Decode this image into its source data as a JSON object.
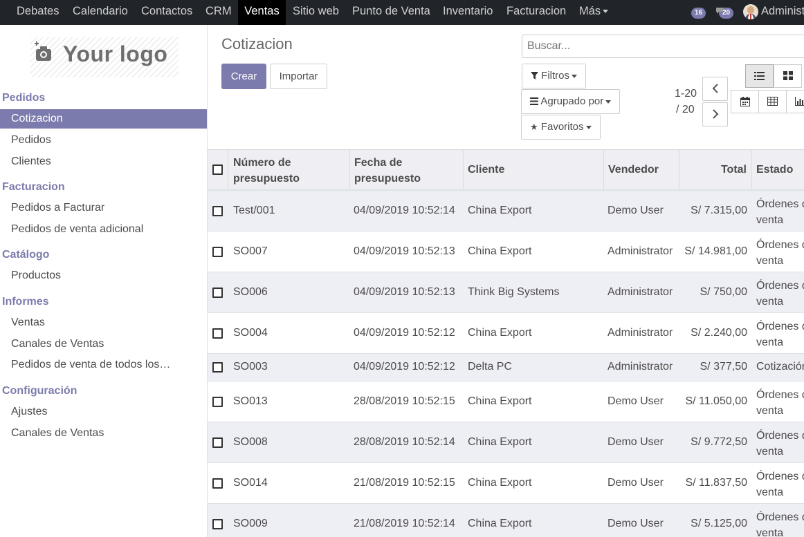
{
  "topnav": {
    "items": [
      "Debates",
      "Calendario",
      "Contactos",
      "CRM",
      "Ventas",
      "Sitio web",
      "Punto de Venta",
      "Inventario",
      "Facturacion"
    ],
    "more_label": "Más",
    "badge_activity": "16",
    "badge_messages": "20",
    "user_name": "Administrator"
  },
  "sidebar": {
    "logo_text": "Your logo",
    "sections": [
      {
        "title": "Pedidos",
        "items": [
          "Cotizacion",
          "Pedidos",
          "Clientes"
        ]
      },
      {
        "title": "Facturacion",
        "items": [
          "Pedidos a Facturar",
          "Pedidos de venta adicional"
        ]
      },
      {
        "title": "Catálogo",
        "items": [
          "Productos"
        ]
      },
      {
        "title": "Informes",
        "items": [
          "Ventas",
          "Canales de Ventas",
          "Pedidos de venta de todos los…"
        ]
      },
      {
        "title": "Configuración",
        "items": [
          "Ajustes",
          "Canales de Ventas"
        ]
      }
    ],
    "active_item": "Cotizacion"
  },
  "control": {
    "title": "Cotizacion",
    "create_label": "Crear",
    "import_label": "Importar",
    "search_placeholder": "Buscar...",
    "filters_label": "Filtros",
    "groupby_label": "Agrupado por",
    "favorites_label": "Favoritos",
    "pager_range": "1-20",
    "pager_total": "/ 20"
  },
  "table": {
    "headers": [
      "Número de presupuesto",
      "Fecha de presupuesto",
      "Cliente",
      "Vendedor",
      "Total",
      "Estado"
    ],
    "rows": [
      {
        "number": "Test/001",
        "date": "04/09/2019 10:52:14",
        "client": "China Export",
        "seller": "Demo User",
        "total": "S/ 7.315,00",
        "state": "Órdenes de venta"
      },
      {
        "number": "SO007",
        "date": "04/09/2019 10:52:13",
        "client": "China Export",
        "seller": "Administrator",
        "total": "S/ 14.981,00",
        "state": "Órdenes de venta"
      },
      {
        "number": "SO006",
        "date": "04/09/2019 10:52:13",
        "client": "Think Big Systems",
        "seller": "Administrator",
        "total": "S/ 750,00",
        "state": "Órdenes de venta"
      },
      {
        "number": "SO004",
        "date": "04/09/2019 10:52:12",
        "client": "China Export",
        "seller": "Administrator",
        "total": "S/ 2.240,00",
        "state": "Órdenes de venta"
      },
      {
        "number": "SO003",
        "date": "04/09/2019 10:52:12",
        "client": "Delta PC",
        "seller": "Administrator",
        "total": "S/ 377,50",
        "state": "Cotización"
      },
      {
        "number": "SO013",
        "date": "28/08/2019 10:52:15",
        "client": "China Export",
        "seller": "Demo User",
        "total": "S/ 11.050,00",
        "state": "Órdenes de venta"
      },
      {
        "number": "SO008",
        "date": "28/08/2019 10:52:14",
        "client": "China Export",
        "seller": "Demo User",
        "total": "S/ 9.772,50",
        "state": "Órdenes de venta"
      },
      {
        "number": "SO014",
        "date": "21/08/2019 10:52:15",
        "client": "China Export",
        "seller": "Demo User",
        "total": "S/ 11.837,50",
        "state": "Órdenes de venta"
      },
      {
        "number": "SO009",
        "date": "21/08/2019 10:52:14",
        "client": "China Export",
        "seller": "Demo User",
        "total": "S/ 5.125,00",
        "state": "Órdenes de venta"
      }
    ]
  },
  "colors": {
    "brand": "#7c7bad",
    "navbar": "#212529",
    "row_alt": "#eeeef5"
  }
}
